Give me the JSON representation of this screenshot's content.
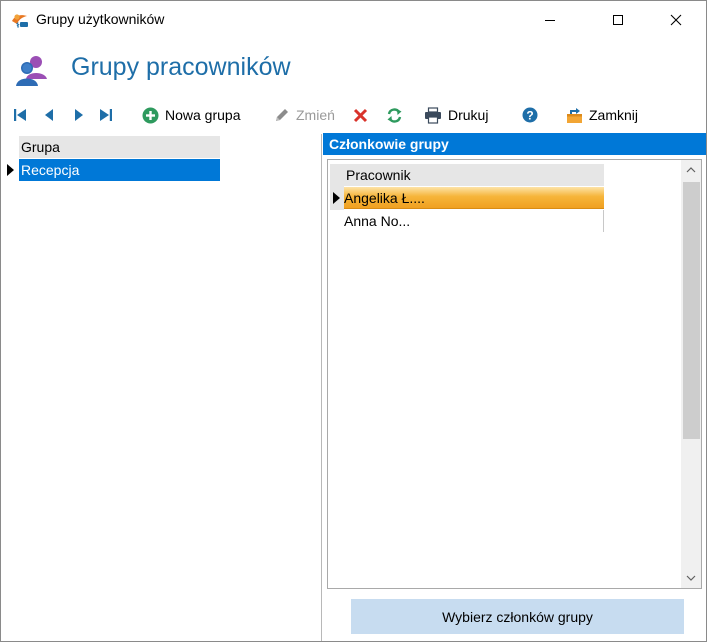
{
  "window": {
    "title": "Grupy użytkowników"
  },
  "header": {
    "title": "Grupy pracowników"
  },
  "toolbar": {
    "new_group": "Nowa grupa",
    "edit": "Zmień",
    "print": "Drukuj",
    "close": "Zamknij"
  },
  "groups_grid": {
    "column": "Grupa",
    "rows": [
      {
        "name": "Recepcja",
        "selected": true
      }
    ]
  },
  "members_panel": {
    "title": "Członkowie grupy",
    "column": "Pracownik",
    "rows": [
      {
        "name": "Angelika Ł....",
        "selected": true
      },
      {
        "name": "Anna No..."
      }
    ],
    "select_button": "Wybierz członków grupy"
  },
  "colors": {
    "accent": "#0078d7",
    "header_title": "#1e6ea8",
    "selected_row": "#f6b53a",
    "select_button": "#c7dcf0"
  }
}
